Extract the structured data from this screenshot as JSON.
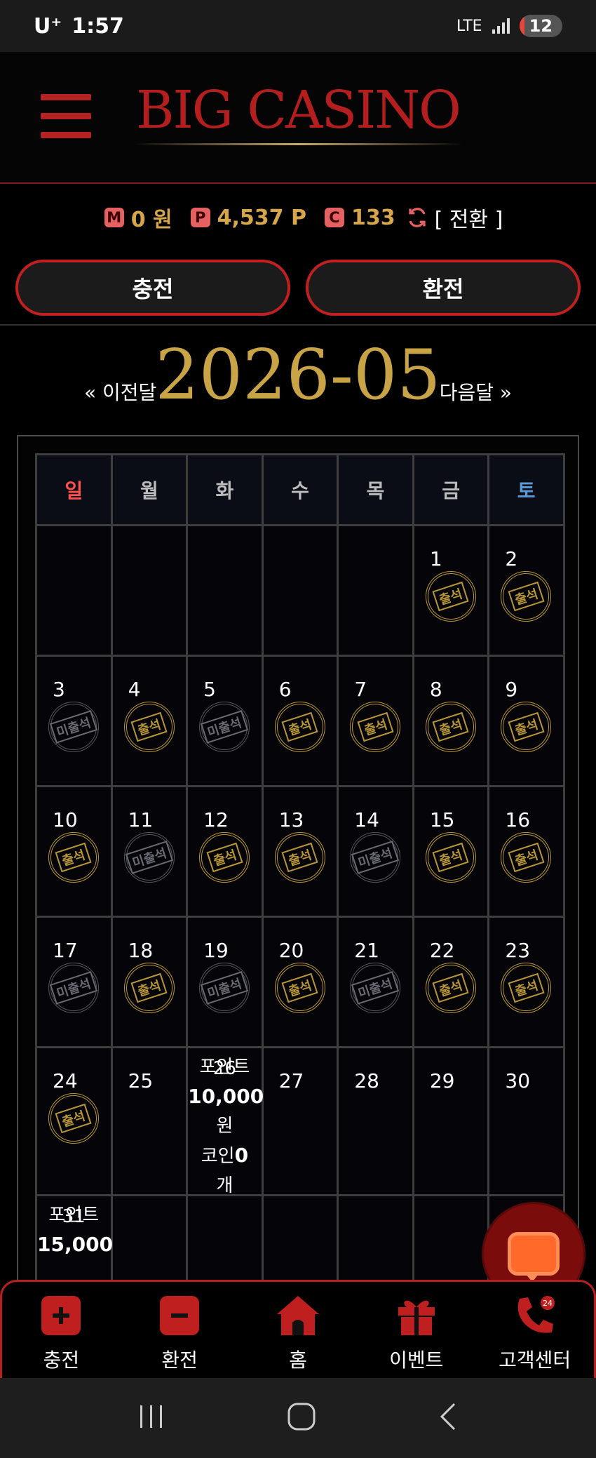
{
  "status_bar": {
    "carrier": "U⁺",
    "time": "1:57",
    "network": "LTE",
    "battery": "12"
  },
  "header": {
    "logo_text": "BIG CASINO"
  },
  "balances": {
    "money_icon": "M",
    "money_value": "0 원",
    "point_icon": "P",
    "point_value": "4,537 P",
    "coin_icon": "C",
    "coin_value": "133",
    "convert_label": "[ 전환 ]"
  },
  "actions": {
    "charge_label": "충전",
    "exchange_label": "환전"
  },
  "month_nav": {
    "prev_label": "« 이전달",
    "title": "2026-05",
    "next_label": "다음달 »"
  },
  "calendar": {
    "weekdays": [
      "일",
      "월",
      "화",
      "수",
      "목",
      "금",
      "토"
    ],
    "stamp_present": "출석",
    "stamp_absent": "미출석",
    "weeks": [
      [
        {
          "day": ""
        },
        {
          "day": ""
        },
        {
          "day": ""
        },
        {
          "day": ""
        },
        {
          "day": ""
        },
        {
          "day": "1",
          "status": "present"
        },
        {
          "day": "2",
          "status": "present"
        }
      ],
      [
        {
          "day": "3",
          "status": "absent"
        },
        {
          "day": "4",
          "status": "present"
        },
        {
          "day": "5",
          "status": "absent"
        },
        {
          "day": "6",
          "status": "present"
        },
        {
          "day": "7",
          "status": "present"
        },
        {
          "day": "8",
          "status": "present"
        },
        {
          "day": "9",
          "status": "present"
        }
      ],
      [
        {
          "day": "10",
          "status": "present"
        },
        {
          "day": "11",
          "status": "absent"
        },
        {
          "day": "12",
          "status": "present"
        },
        {
          "day": "13",
          "status": "present"
        },
        {
          "day": "14",
          "status": "absent"
        },
        {
          "day": "15",
          "status": "present"
        },
        {
          "day": "16",
          "status": "present"
        }
      ],
      [
        {
          "day": "17",
          "status": "absent"
        },
        {
          "day": "18",
          "status": "present"
        },
        {
          "day": "19",
          "status": "absent"
        },
        {
          "day": "20",
          "status": "present"
        },
        {
          "day": "21",
          "status": "absent"
        },
        {
          "day": "22",
          "status": "present"
        },
        {
          "day": "23",
          "status": "present"
        }
      ],
      [
        {
          "day": "24",
          "status": "present"
        },
        {
          "day": "25"
        },
        {
          "day": "26",
          "reward": {
            "line1": "포인트",
            "amount": "10,000",
            "unit": "원",
            "coin_label": "코인",
            "coin_amount": "0",
            "coin_unit": "개"
          }
        },
        {
          "day": "27"
        },
        {
          "day": "28"
        },
        {
          "day": "29"
        },
        {
          "day": "30"
        }
      ],
      [
        {
          "day": "31",
          "reward": {
            "line1": "포인트",
            "amount": "15,000"
          }
        },
        {
          "day": ""
        },
        {
          "day": ""
        },
        {
          "day": ""
        },
        {
          "day": ""
        },
        {
          "day": ""
        },
        {
          "day": ""
        }
      ]
    ]
  },
  "bottom_nav": {
    "items": [
      {
        "label": "충전",
        "icon": "plus-square-icon"
      },
      {
        "label": "환전",
        "icon": "minus-square-icon"
      },
      {
        "label": "홈",
        "icon": "home-icon"
      },
      {
        "label": "이벤트",
        "icon": "gift-icon"
      },
      {
        "label": "고객센터",
        "icon": "phone-24-icon"
      }
    ]
  },
  "colors": {
    "accent_red": "#b41e1e",
    "gold": "#c9a447",
    "sunday": "#ff4f4f",
    "saturday": "#5a9ad8"
  }
}
